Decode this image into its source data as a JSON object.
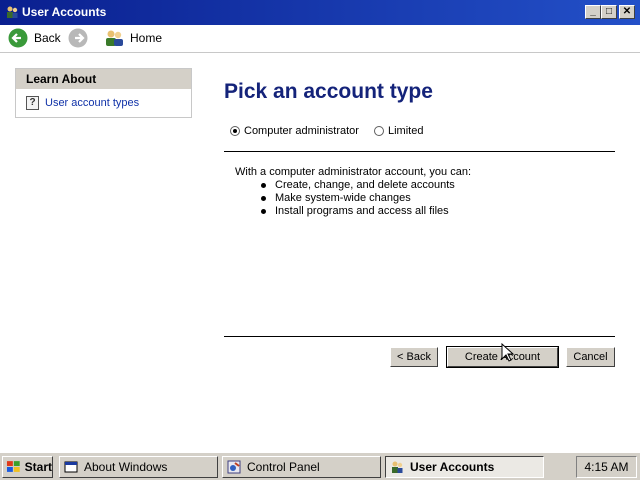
{
  "window": {
    "title": "User Accounts"
  },
  "toolbar": {
    "back_label": "Back",
    "home_label": "Home"
  },
  "learn_about": {
    "heading": "Learn About",
    "link_label": "User account types"
  },
  "main": {
    "heading": "Pick an account type",
    "radio_admin": "Computer administrator",
    "radio_limited": "Limited",
    "selected": "Computer administrator",
    "description": "With a computer administrator account, you can:",
    "bullets": [
      "Create, change, and delete accounts",
      "Make system-wide changes",
      "Install programs and access all files"
    ],
    "back_button": "< Back",
    "create_button": "Create Account",
    "cancel_button": "Cancel"
  },
  "taskbar": {
    "start_label": "Start",
    "tasks": [
      {
        "label": "About Windows"
      },
      {
        "label": "Control Panel"
      },
      {
        "label": "User Accounts"
      }
    ],
    "clock": "4:15 AM"
  },
  "colors": {
    "titlebar": "#0a1f8f",
    "heading": "#14237a",
    "link": "#1032a8"
  }
}
